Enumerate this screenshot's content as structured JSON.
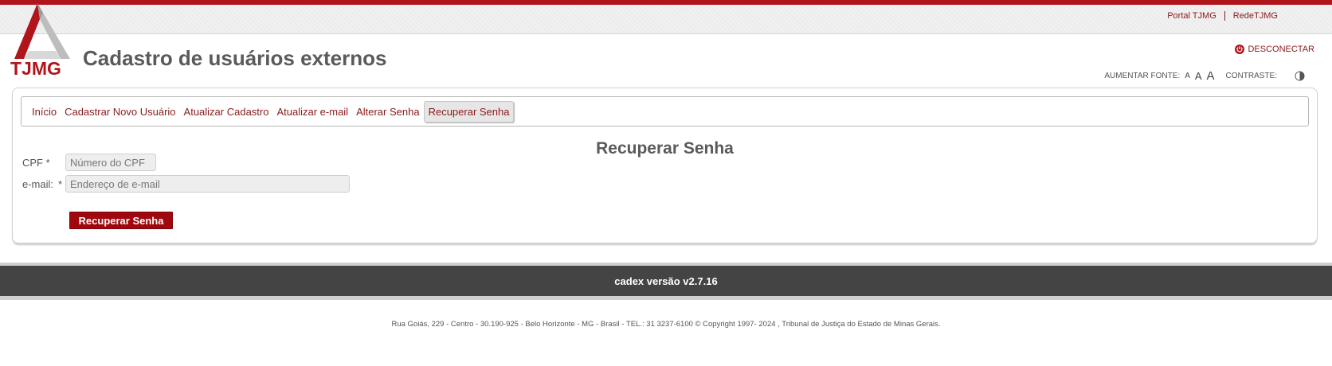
{
  "header": {
    "links": [
      "Portal TJMG",
      "RedeTJMG"
    ],
    "logo_text": "TJMG",
    "title": "Cadastro de usuários externos",
    "logout_label": "DESCONECTAR"
  },
  "accessibility": {
    "font_label": "AUMENTAR FONTE:",
    "font_sizes": [
      "A",
      "A",
      "A"
    ],
    "contrast_label": "CONTRASTE:"
  },
  "nav": {
    "items": [
      "Início",
      "Cadastrar Novo Usuário",
      "Atualizar Cadastro",
      "Atualizar e-mail",
      "Alterar Senha",
      "Recuperar Senha"
    ],
    "active": "Recuperar Senha"
  },
  "form": {
    "title": "Recuperar Senha",
    "cpf_label": "CPF *",
    "cpf_placeholder": "Número do CPF",
    "cpf_value": "",
    "email_label": "e-mail:",
    "email_required": "*",
    "email_placeholder": "Endereço de e-mail",
    "email_value": "",
    "submit_label": "Recuperar Senha"
  },
  "footer": {
    "version": "cadex versão v2.7.16",
    "address": "Rua Goiás, 229 - Centro - 30.190-925 - Belo Horizonte - MG - Brasil - TEL.: 31 3237-6100 © Copyright 1997- 2024 , Tribunal de Justiça do Estado de Minas Gerais."
  },
  "colors": {
    "brand_red": "#b0151c",
    "link_red": "#8b1a1a",
    "button_red": "#a0080e",
    "footer_dark": "#444444"
  }
}
